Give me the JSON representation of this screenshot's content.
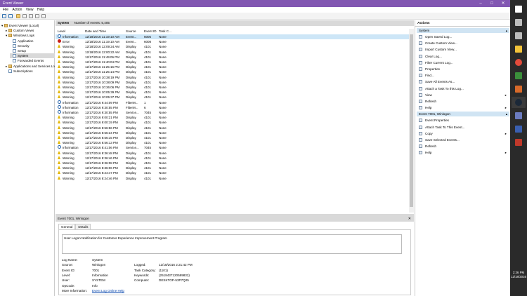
{
  "window": {
    "title": "Event Viewer",
    "minimize_glyph": "–",
    "maximize_glyph": "□",
    "close_glyph": "✕"
  },
  "menu": [
    "File",
    "Action",
    "View",
    "Help"
  ],
  "tree": [
    {
      "label": "Event Viewer (Local)",
      "icon": "computer-icon",
      "level": 0,
      "expander": "▾"
    },
    {
      "label": "Custom Views",
      "icon": "folder-icon",
      "level": 1,
      "expander": "▸"
    },
    {
      "label": "Windows Logs",
      "icon": "folder-icon",
      "level": 1,
      "expander": "▾"
    },
    {
      "label": "Application",
      "icon": "log-icon",
      "level": 2,
      "expander": ""
    },
    {
      "label": "Security",
      "icon": "log-icon",
      "level": 2,
      "expander": ""
    },
    {
      "label": "Setup",
      "icon": "log-icon",
      "level": 2,
      "expander": ""
    },
    {
      "label": "System",
      "icon": "log-icon",
      "level": 2,
      "expander": "",
      "selected": true
    },
    {
      "label": "Forwarded Events",
      "icon": "log-icon",
      "level": 2,
      "expander": ""
    },
    {
      "label": "Applications and Services Lo",
      "icon": "folder-icon",
      "level": 1,
      "expander": "▸"
    },
    {
      "label": "Subscriptions",
      "icon": "log-icon",
      "level": 1,
      "expander": ""
    }
  ],
  "log_header": {
    "name": "System",
    "count": "Number of events: 5,405"
  },
  "columns": [
    "Level",
    "Date and Time",
    "Source",
    "Event ID",
    "Task C..."
  ],
  "events": [
    {
      "level": "Information",
      "date": "12/18/2016 11:19:10 AM",
      "source": "Event...",
      "id": "6005",
      "task": "None"
    },
    {
      "level": "Error",
      "date": "12/18/2016 11:19:10 AM",
      "source": "Event...",
      "id": "6008",
      "task": "None"
    },
    {
      "level": "Warning",
      "date": "12/18/2016 12:09:24 AM",
      "source": "Display",
      "id": "4101",
      "task": "None"
    },
    {
      "level": "Warning",
      "date": "12/18/2016 12:00:22 AM",
      "source": "Display",
      "id": "4101",
      "task": "None"
    },
    {
      "level": "Warning",
      "date": "12/17/2016 11:49:06 PM",
      "source": "Display",
      "id": "4101",
      "task": "None"
    },
    {
      "level": "Warning",
      "date": "12/17/2016 11:40:04 PM",
      "source": "Display",
      "id": "4101",
      "task": "None"
    },
    {
      "level": "Warning",
      "date": "12/17/2016 11:25:16 PM",
      "source": "Display",
      "id": "4101",
      "task": "None"
    },
    {
      "level": "Warning",
      "date": "12/17/2016 11:25:14 PM",
      "source": "Display",
      "id": "4101",
      "task": "None"
    },
    {
      "level": "Warning",
      "date": "12/17/2016 10:38:19 PM",
      "source": "Display",
      "id": "4101",
      "task": "None"
    },
    {
      "level": "Warning",
      "date": "12/17/2016 10:38:09 PM",
      "source": "Display",
      "id": "4101",
      "task": "None"
    },
    {
      "level": "Warning",
      "date": "12/17/2016 10:36:06 PM",
      "source": "Display",
      "id": "4101",
      "task": "None"
    },
    {
      "level": "Warning",
      "date": "12/17/2016 10:05:39 PM",
      "source": "Display",
      "id": "4101",
      "task": "None"
    },
    {
      "level": "Warning",
      "date": "12/17/2016 10:05:37 PM",
      "source": "Display",
      "id": "4101",
      "task": "None"
    },
    {
      "level": "Information",
      "date": "12/17/2016 9:44:09 PM",
      "source": "FilterM...",
      "id": "1",
      "task": "None"
    },
    {
      "level": "Information",
      "date": "12/17/2016 9:30:55 PM",
      "source": "FilterM...",
      "id": "6",
      "task": "None"
    },
    {
      "level": "Information",
      "date": "12/17/2016 9:30:55 PM",
      "source": "Service...",
      "id": "7045",
      "task": "None"
    },
    {
      "level": "Warning",
      "date": "12/17/2016 9:00:21 PM",
      "source": "Display",
      "id": "4101",
      "task": "None"
    },
    {
      "level": "Warning",
      "date": "12/17/2016 9:00:19 PM",
      "source": "Display",
      "id": "4101",
      "task": "None"
    },
    {
      "level": "Warning",
      "date": "12/17/2016 8:56:56 PM",
      "source": "Display",
      "id": "4101",
      "task": "None"
    },
    {
      "level": "Warning",
      "date": "12/17/2016 8:56:34 PM",
      "source": "Display",
      "id": "4101",
      "task": "None"
    },
    {
      "level": "Warning",
      "date": "12/17/2016 8:56:15 PM",
      "source": "Display",
      "id": "4101",
      "task": "None"
    },
    {
      "level": "Warning",
      "date": "12/17/2016 8:56:13 PM",
      "source": "Display",
      "id": "4101",
      "task": "None"
    },
    {
      "level": "Information",
      "date": "12/17/2016 8:41:06 PM",
      "source": "Service...",
      "id": "7045",
      "task": "None"
    },
    {
      "level": "Warning",
      "date": "12/17/2016 8:36:48 PM",
      "source": "Display",
      "id": "4101",
      "task": "None"
    },
    {
      "level": "Warning",
      "date": "12/17/2016 8:36:46 PM",
      "source": "Display",
      "id": "4101",
      "task": "None"
    },
    {
      "level": "Warning",
      "date": "12/17/2016 8:36:08 PM",
      "source": "Display",
      "id": "4101",
      "task": "None"
    },
    {
      "level": "Warning",
      "date": "12/17/2016 8:36:06 PM",
      "source": "Display",
      "id": "4101",
      "task": "None"
    },
    {
      "level": "Warning",
      "date": "12/17/2016 8:24:47 PM",
      "source": "Display",
      "id": "4101",
      "task": "None"
    },
    {
      "level": "Warning",
      "date": "12/17/2016 8:24:46 PM",
      "source": "Display",
      "id": "4101",
      "task": "None"
    }
  ],
  "detail": {
    "title": "Event 7001, Winlogon",
    "close_glyph": "✕",
    "tabs": [
      "General",
      "Details"
    ],
    "message": "User Logon Notification for Customer Experience Improvement Program",
    "left": [
      {
        "label": "Log Name:",
        "value": "System"
      },
      {
        "label": "Source:",
        "value": "Winlogon"
      },
      {
        "label": "Event ID:",
        "value": "7001"
      },
      {
        "label": "Level:",
        "value": "Information"
      },
      {
        "label": "User:",
        "value": "SYSTEM"
      },
      {
        "label": "OpCode:",
        "value": "Info"
      },
      {
        "label": "More Information:",
        "value": "Event Log Online Help"
      }
    ],
    "right": [
      {
        "label": "Logged:",
        "value": "12/18/2016 2:21:42 PM"
      },
      {
        "label": "Task Category:",
        "value": "(1101)"
      },
      {
        "label": "Keywords:",
        "value": "(2518437120589832)"
      },
      {
        "label": "Computer:",
        "value": "DESKTOP-53P7Q25"
      }
    ]
  },
  "actions": {
    "title": "Actions",
    "sections": [
      {
        "title": "System",
        "items": [
          {
            "label": "Open Saved Log...",
            "arrow": ""
          },
          {
            "label": "Create Custom View...",
            "arrow": ""
          },
          {
            "label": "Import Custom View...",
            "arrow": ""
          },
          {
            "label": "Clear Log...",
            "arrow": ""
          },
          {
            "label": "Filter Current Log...",
            "arrow": ""
          },
          {
            "label": "Properties",
            "arrow": ""
          },
          {
            "label": "Find...",
            "arrow": ""
          },
          {
            "label": "Save All Events As...",
            "arrow": ""
          },
          {
            "label": "Attach a Task To this Log...",
            "arrow": ""
          },
          {
            "label": "View",
            "arrow": "▸"
          },
          {
            "label": "Refresh",
            "arrow": ""
          },
          {
            "label": "Help",
            "arrow": "▸"
          }
        ]
      },
      {
        "title": "Event 7001, Winlogon",
        "items": [
          {
            "label": "Event Properties",
            "arrow": ""
          },
          {
            "label": "Attach Task To This Event...",
            "arrow": ""
          },
          {
            "label": "Copy",
            "arrow": "▸"
          },
          {
            "label": "Save Selected Events...",
            "arrow": ""
          },
          {
            "label": "Refresh",
            "arrow": ""
          },
          {
            "label": "Help",
            "arrow": "▸"
          }
        ]
      }
    ]
  },
  "taskbar": {
    "time": "2:26 PM",
    "date": "12/18/2016",
    "icons": [
      "windows-start-icon",
      "search-icon",
      "task-view-icon",
      "explorer-icon",
      "chrome-icon",
      "calculator-icon",
      "app-icon",
      "steam-icon",
      "event-viewer-icon",
      "app-icon",
      "app-icon"
    ],
    "icon_colors": [
      "#ffffff",
      "#bdbdbd",
      "#bdbdbd",
      "#f3c33a",
      "#e24b3b",
      "#3b8f3b",
      "#d86a2a",
      "#1b2838",
      "#6b7bbf",
      "#3a5fb0",
      "#c0392b"
    ]
  },
  "colors": {
    "title_bar": "#8257b2",
    "selected_row": "#cde6f7",
    "section_header": "#d0e4f3",
    "warning": "#e3b600",
    "error": "#c8201a",
    "information": "#1f5ea8"
  }
}
